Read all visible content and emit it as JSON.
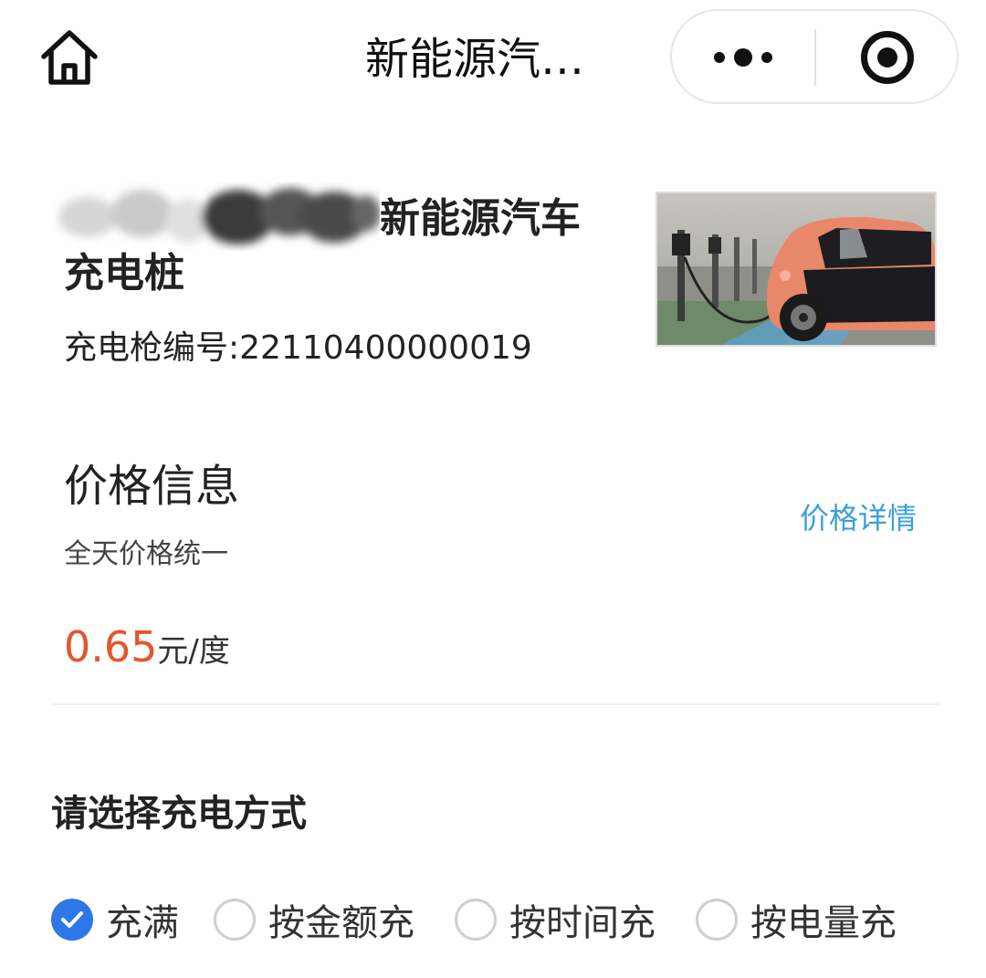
{
  "nav": {
    "title": "新能源汽…",
    "home_icon": "home-icon",
    "menu_icon": "more-dots-icon",
    "close_icon": "target-close-icon"
  },
  "station": {
    "name_tail": "新能源汽车",
    "name_line2": "充电桩",
    "gun_label": "充电枪编号:",
    "gun_no": "22110400000019"
  },
  "price": {
    "title": "价格信息",
    "subtitle": "全天价格统一",
    "detail_link": "价格详情",
    "value": "0.65",
    "unit": "元/度"
  },
  "charge_mode": {
    "title": "请选择充电方式",
    "options": [
      {
        "label": "充满",
        "checked": true
      },
      {
        "label": "按金额充",
        "checked": false
      },
      {
        "label": "按时间充",
        "checked": false
      },
      {
        "label": "按电量充",
        "checked": false
      }
    ]
  },
  "colors": {
    "accent_blue": "#2f76e8",
    "link_blue": "#3aa0d8",
    "price_orange": "#e2572b"
  }
}
